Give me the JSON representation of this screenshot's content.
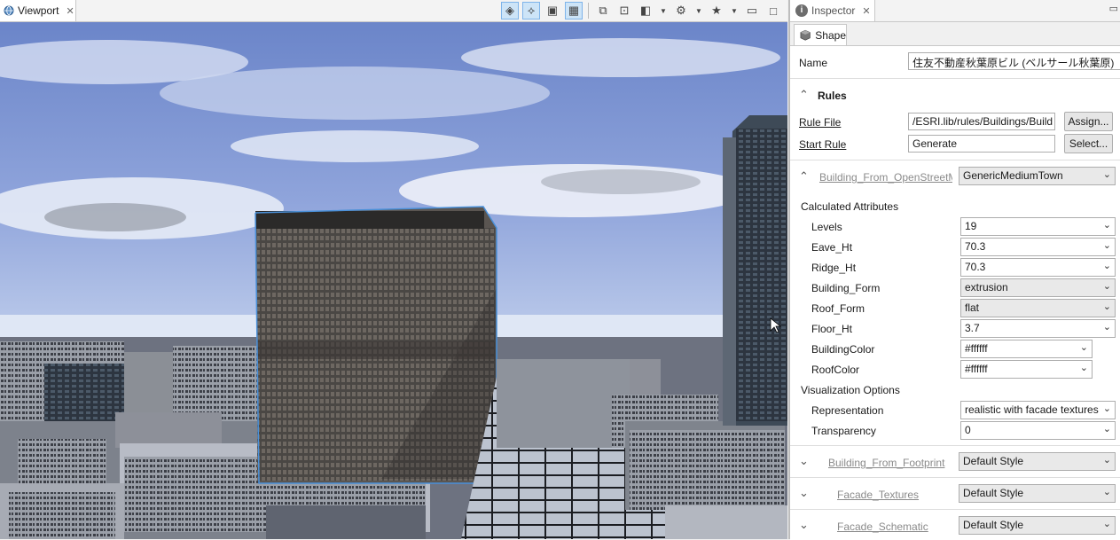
{
  "viewport": {
    "tab_label": "Viewport",
    "toolbar_icons": [
      "layers-icon",
      "wireframe-icon",
      "shaded-icon",
      "textured-icon",
      "camera-bookmark-icon",
      "snapshot-icon",
      "video-camera-icon",
      "gear-icon",
      "star-icon"
    ]
  },
  "inspector": {
    "tab_label": "Inspector",
    "shape_tab": "Shape",
    "name_label": "Name",
    "name_value": "住友不動産秋葉原ビル (ベルサール秋葉原)",
    "rules_header": "Rules",
    "rule_file_label": "Rule File",
    "rule_file_value": "/ESRI.lib/rules/Buildings/Build",
    "assign_button": "Assign...",
    "start_rule_label": "Start Rule",
    "start_rule_value": "Generate",
    "select_button": "Select...",
    "group_osm": {
      "label": "Building_From_OpenStreetM",
      "style": "GenericMediumTown"
    },
    "calculated_header": "Calculated Attributes",
    "attributes": [
      {
        "label": "Levels",
        "value": "19"
      },
      {
        "label": "Eave_Ht",
        "value": "70.3"
      },
      {
        "label": "Ridge_Ht",
        "value": "70.3"
      },
      {
        "label": "Building_Form",
        "value": "extrusion"
      },
      {
        "label": "Roof_Form",
        "value": "flat"
      },
      {
        "label": "Floor_Ht",
        "value": "3.7"
      },
      {
        "label": "BuildingColor",
        "value": "#ffffff"
      },
      {
        "label": "RoofColor",
        "value": "#ffffff"
      }
    ],
    "visualization_header": "Visualization Options",
    "vis_options": [
      {
        "label": "Representation",
        "value": "realistic with facade textures"
      },
      {
        "label": "Transparency",
        "value": "0"
      }
    ],
    "groups": [
      {
        "label": "Building_From_Footprint",
        "style": "Default Style"
      },
      {
        "label": "Facade_Textures",
        "style": "Default Style"
      },
      {
        "label": "Facade_Schematic",
        "style": "Default Style"
      }
    ]
  },
  "colors": {
    "accent_selection": "#4a90d9",
    "tab_active": "#ffffff"
  }
}
